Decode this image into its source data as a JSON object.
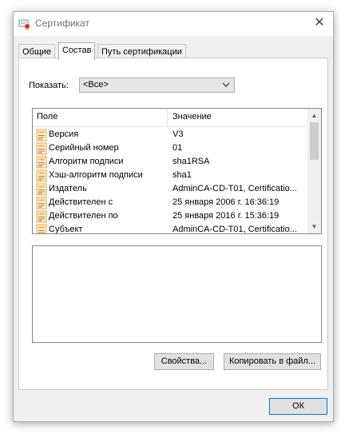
{
  "window": {
    "title": "Сертификат",
    "icons": {
      "title": "certificate-icon",
      "close": "close-icon"
    }
  },
  "tabs": [
    {
      "label": "Общие",
      "active": false
    },
    {
      "label": "Состав",
      "active": true
    },
    {
      "label": "Путь сертификации",
      "active": false
    }
  ],
  "show": {
    "label": "Показать:",
    "value": "<Все>"
  },
  "list": {
    "columns": {
      "field": "Поле",
      "value": "Значение"
    },
    "rows": [
      {
        "field": "Версия",
        "value": "V3"
      },
      {
        "field": "Серийный номер",
        "value": "01"
      },
      {
        "field": "Алгоритм подписи",
        "value": "sha1RSA"
      },
      {
        "field": "Хэш-алгоритм подписи",
        "value": "sha1"
      },
      {
        "field": "Издатель",
        "value": "AdminCA-CD-T01, Certificatio..."
      },
      {
        "field": "Действителен с",
        "value": "25 января 2006 г. 16:36:19"
      },
      {
        "field": "Действителен по",
        "value": "25 января 2016 г. 15:36:19"
      },
      {
        "field": "Субъект",
        "value": "AdminCA-CD-T01, Certificatio..."
      }
    ]
  },
  "buttons": {
    "properties": "Свойства...",
    "copy": "Копировать в файл...",
    "ok": "ОК"
  },
  "colors": {
    "field_icon": "#e8a040",
    "ok_border": "#0078d7"
  }
}
